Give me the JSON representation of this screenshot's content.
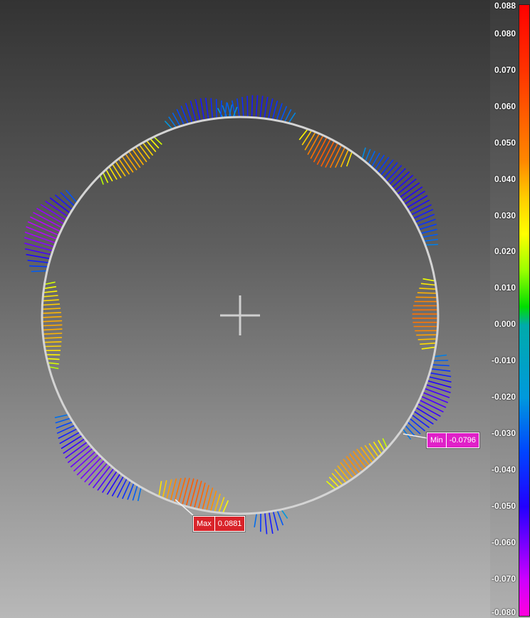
{
  "legend": {
    "ticks": [
      "0.088",
      "0.080",
      "0.070",
      "0.060",
      "0.050",
      "0.040",
      "0.030",
      "0.020",
      "0.010",
      "0.000",
      "-0.010",
      "-0.020",
      "-0.030",
      "-0.040",
      "-0.050",
      "-0.060",
      "-0.070",
      "-0.080"
    ],
    "range": [
      -0.08,
      0.088
    ]
  },
  "callouts": {
    "max": {
      "label": "Max",
      "value": "0.0881"
    },
    "min": {
      "label": "Min",
      "value": "-0.0796"
    }
  },
  "colors": {
    "reference_circle": "#d4d4d4",
    "center_cross": "#cfcfcf"
  }
}
